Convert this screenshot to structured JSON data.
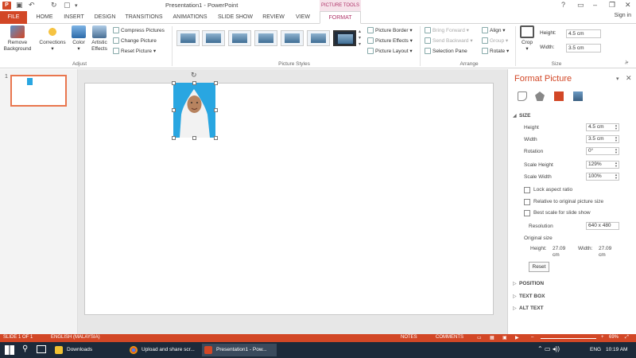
{
  "app": {
    "title": "Presentation1 - PowerPoint",
    "context_tab_header": "PICTURE TOOLS",
    "sign_in": "Sign in"
  },
  "tabs": [
    "FILE",
    "HOME",
    "INSERT",
    "DESIGN",
    "TRANSITIONS",
    "ANIMATIONS",
    "SLIDE SHOW",
    "REVIEW",
    "VIEW",
    "FORMAT"
  ],
  "ribbon": {
    "adjust": {
      "label": "Adjust",
      "remove_background": "Remove Background",
      "corrections": "Corrections",
      "color": "Color",
      "artistic_effects": "Artistic Effects",
      "compress_pictures": "Compress Pictures",
      "change_picture": "Change Picture",
      "reset_picture": "Reset Picture"
    },
    "picture_styles": {
      "label": "Picture Styles",
      "picture_border": "Picture Border",
      "picture_effects": "Picture Effects",
      "picture_layout": "Picture Layout"
    },
    "arrange": {
      "label": "Arrange",
      "bring_forward": "Bring Forward",
      "send_backward": "Send Backward",
      "selection_pane": "Selection Pane",
      "align": "Align",
      "group": "Group",
      "rotate": "Rotate"
    },
    "size": {
      "label": "Size",
      "crop": "Crop",
      "height_label": "Height:",
      "height_value": "4.5 cm",
      "width_label": "Width:",
      "width_value": "3.5 cm"
    }
  },
  "thumbnails": {
    "slide_number": "1"
  },
  "format_pane": {
    "title": "Format Picture",
    "size_section": "SIZE",
    "height_label": "Height",
    "height_value": "4.5 cm",
    "width_label": "Width",
    "width_value": "3.5 cm",
    "rotation_label": "Rotation",
    "rotation_value": "0°",
    "scale_height_label": "Scale Height",
    "scale_height_value": "129%",
    "scale_width_label": "Scale Width",
    "scale_width_value": "100%",
    "lock_aspect": "Lock aspect ratio",
    "relative_original": "Relative to original picture size",
    "best_scale": "Best scale for slide show",
    "resolution_label": "Resolution",
    "resolution_value": "640 x 480",
    "original_size_label": "Original size",
    "orig_height_label": "Height:",
    "orig_height_value": "27.09 cm",
    "orig_width_label": "Width:",
    "orig_width_value": "27.09 cm",
    "reset": "Reset",
    "position_section": "POSITION",
    "text_box_section": "TEXT BOX",
    "alt_text_section": "ALT TEXT"
  },
  "status": {
    "slide": "SLIDE 1 OF 1",
    "language": "ENGLISH (MALAYSIA)",
    "notes": "NOTES",
    "comments": "COMMENTS",
    "zoom": "69%"
  },
  "taskbar": {
    "downloads": "Downloads",
    "chrome": "Upload and share scr...",
    "powerpoint": "Presentation1 - Pow...",
    "lang": "ENG",
    "time": "10:19 AM"
  },
  "colors": {
    "accent": "#d24726",
    "picture_bg": "#29a6e1",
    "format_tab": "#b0356a"
  }
}
